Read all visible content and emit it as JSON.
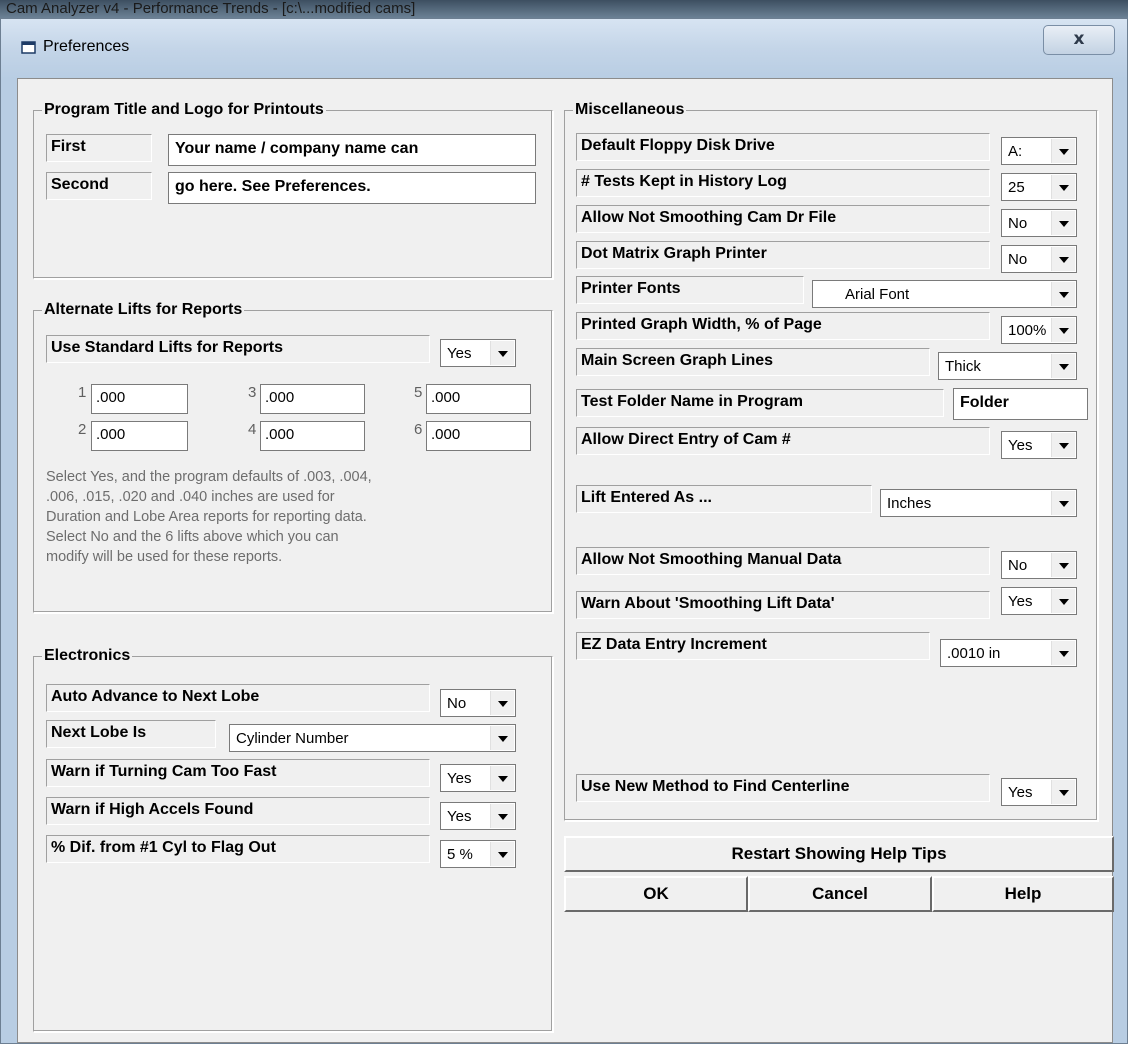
{
  "background_title": "Cam Analyzer v4 - Performance Trends - [c:\\...modified cams]",
  "window": {
    "title": "Preferences",
    "close_label": "x"
  },
  "program_title": {
    "legend": "Program Title and Logo for Printouts",
    "first_label": "First",
    "first_value": "Your name / company name can",
    "second_label": "Second",
    "second_value": "go here.  See Preferences."
  },
  "alternate_lifts": {
    "legend": "Alternate Lifts for Reports",
    "use_standard_label": "Use Standard Lifts for Reports",
    "use_standard_value": "Yes",
    "lifts": [
      {
        "n": "1",
        "v": ".000"
      },
      {
        "n": "3",
        "v": ".000"
      },
      {
        "n": "5",
        "v": ".000"
      },
      {
        "n": "2",
        "v": ".000"
      },
      {
        "n": "4",
        "v": ".000"
      },
      {
        "n": "6",
        "v": ".000"
      }
    ],
    "note_lines": [
      "Select Yes, and the program defaults of .003, .004,",
      ".006, .015, .020 and .040 inches  are used for",
      "Duration and Lobe Area reports for reporting data.",
      "Select No and the 6 lifts above which you can",
      "modify will be used for these reports."
    ]
  },
  "electronics": {
    "legend": "Electronics",
    "auto_advance_label": "Auto Advance to Next Lobe",
    "auto_advance_value": "No",
    "next_lobe_label": "Next Lobe Is",
    "next_lobe_value": "Cylinder Number",
    "warn_turning_label": "Warn if Turning Cam Too Fast",
    "warn_turning_value": "Yes",
    "warn_accels_label": "Warn if High Accels Found",
    "warn_accels_value": "Yes",
    "pct_dif_label": "% Dif. from #1 Cyl to Flag Out",
    "pct_dif_value": "5 %"
  },
  "misc": {
    "legend": "Miscellaneous",
    "floppy_label": "Default Floppy Disk Drive",
    "floppy_value": "A:",
    "tests_kept_label": "# Tests Kept in History Log",
    "tests_kept_value": "25",
    "allow_not_smooth_label": "Allow Not Smoothing Cam Dr File",
    "allow_not_smooth_value": "No",
    "dot_matrix_label": "Dot Matrix Graph Printer",
    "dot_matrix_value": "No",
    "printer_fonts_label": "Printer Fonts",
    "printer_fonts_value": "Arial Font",
    "graph_width_label": "Printed Graph Width, % of Page",
    "graph_width_value": "100%",
    "graph_lines_label": "Main Screen Graph Lines",
    "graph_lines_value": "Thick",
    "test_folder_label": "Test Folder Name in Program",
    "test_folder_value": "Folder",
    "direct_entry_label": "Allow Direct Entry of Cam #",
    "direct_entry_value": "Yes",
    "lift_entered_label": "Lift Entered As ...",
    "lift_entered_value": "Inches",
    "manual_data_label": "Allow Not Smoothing Manual Data",
    "manual_data_value": "No",
    "warn_smoothing_label": "Warn About 'Smoothing Lift Data'",
    "warn_smoothing_value": "Yes",
    "ez_increment_label": "EZ Data Entry Increment",
    "ez_increment_value": ".0010 in",
    "centerline_label": "Use New Method to Find Centerline",
    "centerline_value": "Yes"
  },
  "buttons": {
    "restart_tips": "Restart Showing Help Tips",
    "ok": "OK",
    "cancel": "Cancel",
    "help": "Help"
  }
}
